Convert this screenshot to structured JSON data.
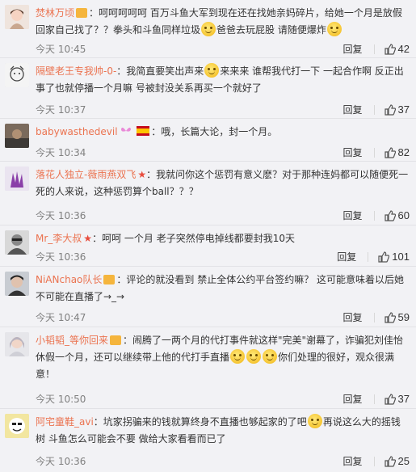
{
  "reply_label": "回复",
  "comments": [
    {
      "username": "焚林万顷",
      "text_a": "：呵呵呵呵呵 百万斗鱼大军到现在还在找她亲妈碎片，给她一个月是放假回家自己找了？？拳头和斗鱼同样垃圾",
      "text_b": "爸爸去玩屁股 请随便爆炸",
      "time": "今天 10:45",
      "likes": "42"
    },
    {
      "username": "隔壁老王专我帅-0-",
      "text_a": "：我简直要笑出声来",
      "text_b": "来来来 谁帮我代打一下 一起合作啊 反正出事了也就停播一个月嘛 号被封没关系再买一个就好了",
      "time": "今天 10:37",
      "likes": "37"
    },
    {
      "username": "babywasthedevil",
      "text_a": "：哦，长篇大论，封一个月。",
      "time": "今天 10:34",
      "likes": "82"
    },
    {
      "username": "落花人独立-薇雨燕双飞",
      "text_a": "：我就问你这个惩罚有意义麽？对于那种连妈都可以随便死一死的人来说，这种惩罚算个ball？？？",
      "time": "今天 10:36",
      "likes": "60"
    },
    {
      "username": "Mr_李大叔",
      "text_a": "：呵呵 一个月 老子突然停电掉线都要封我10天",
      "time": "今天 10:36",
      "likes": "101"
    },
    {
      "username": "NiANchao队长",
      "text_a": "：评论的就没看到 禁止全体公约平台签约嘛？ 这可能意味着以后她不可能在直播了→_→",
      "time": "今天 10:47",
      "likes": "59"
    },
    {
      "username": "小韬韬_等你回来",
      "text_a": "：闹腾了一两个月的代打事件就这样\"完美\"谢幕了，诈骗犯刘佳怡休假一个月，还可以继续带上他的代打手直播",
      "text_b": "你们处理的很好，观众很满意！",
      "time": "今天 10:50",
      "likes": "37"
    },
    {
      "username": "阿宅童鞋_avi",
      "text_a": "：坑家拐骗来的钱就算终身不直播也够起家的了吧",
      "text_b": "再说这么大的摇钱树 斗鱼怎么可能会不要 做给大家看看而已了",
      "time": "今天 10:36",
      "likes": "25"
    }
  ]
}
